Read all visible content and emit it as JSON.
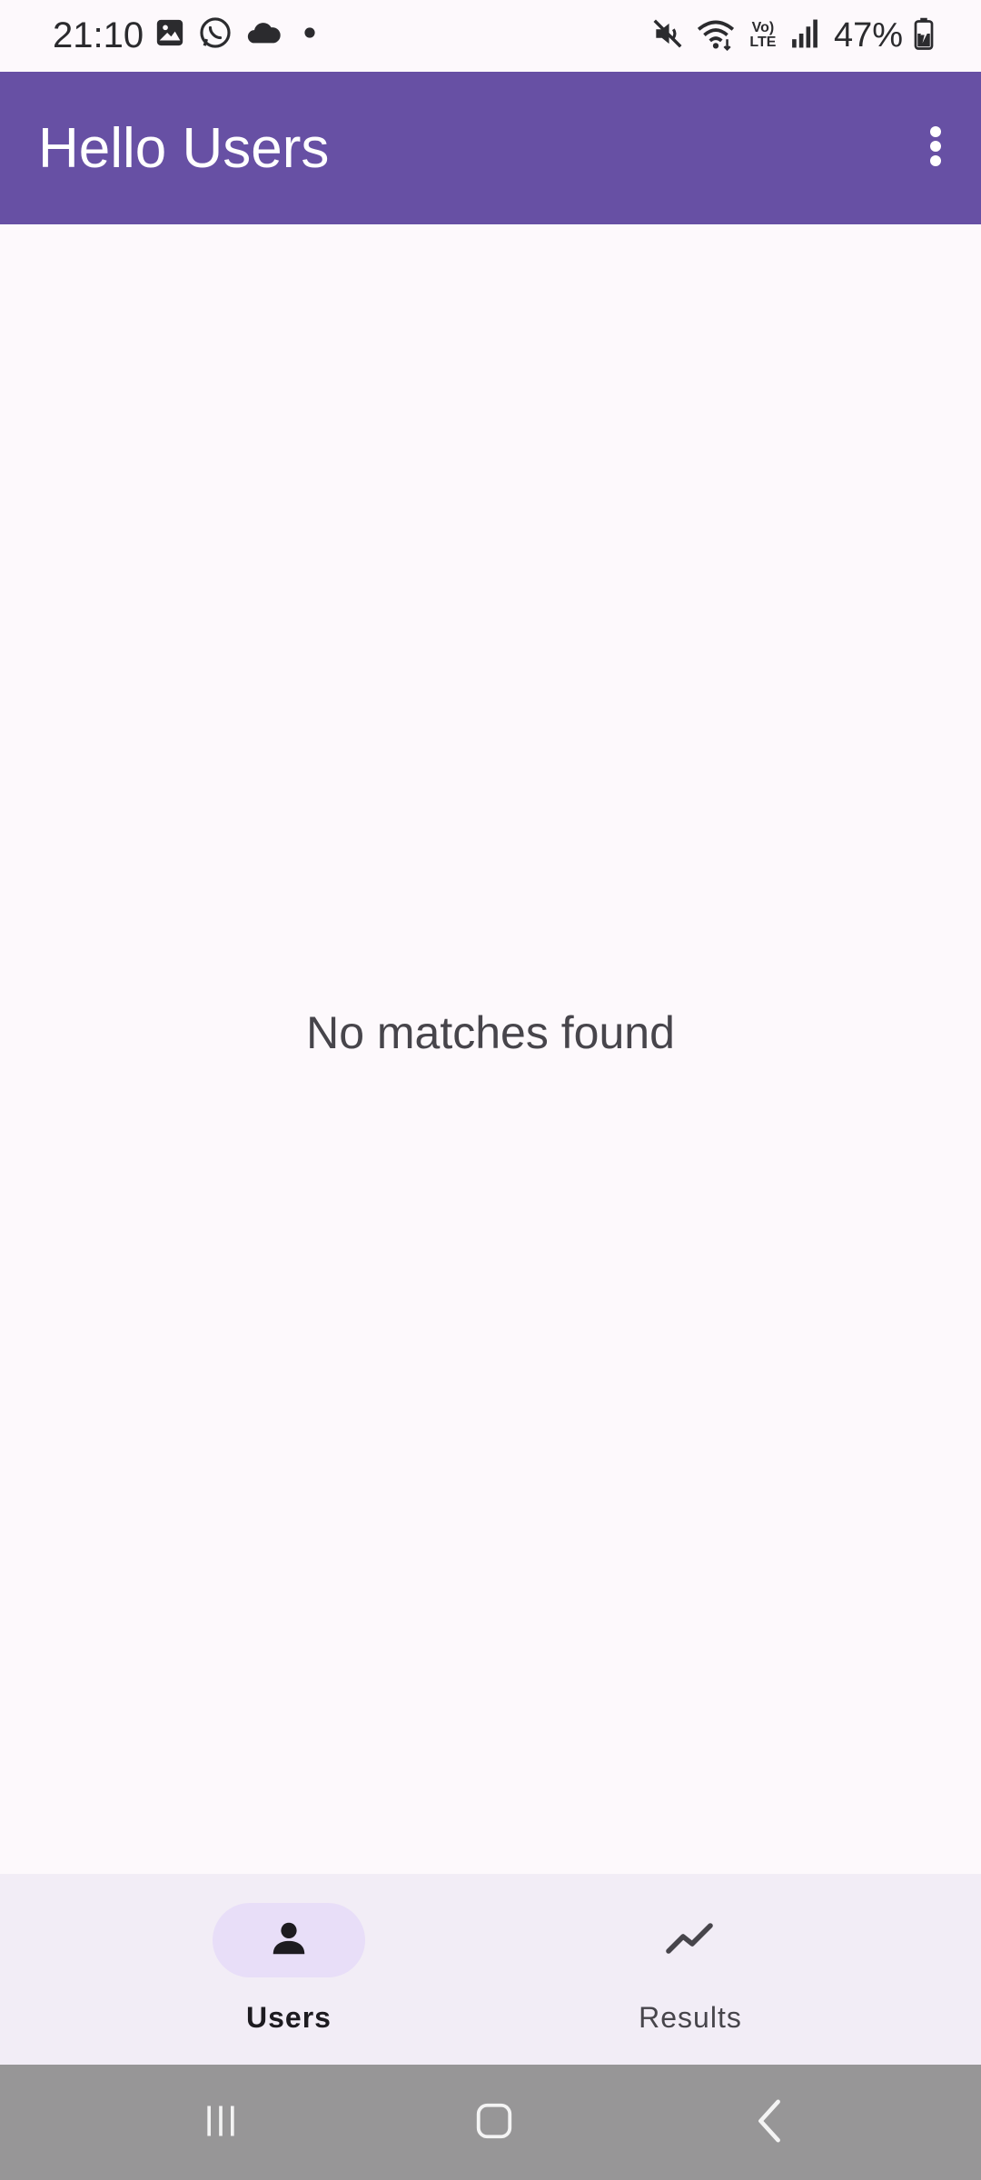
{
  "status_bar": {
    "time": "21:10",
    "battery_text": "47%",
    "network_label": "Vo) LTE",
    "icons": [
      "gallery-icon",
      "whatsapp-icon",
      "cloud-icon",
      "dot-icon",
      "mute-icon",
      "wifi-icon",
      "volte-icon",
      "signal-icon",
      "battery-charging-icon"
    ]
  },
  "app_bar": {
    "title": "Hello Users",
    "overflow_icon": "more-vert-icon",
    "background_color": "#6750a4"
  },
  "content": {
    "empty_message": "No matches found"
  },
  "bottom_nav": {
    "items": [
      {
        "label": "Users",
        "icon": "person-icon",
        "selected": true
      },
      {
        "label": "Results",
        "icon": "trending-line-icon",
        "selected": false
      }
    ],
    "active_indicator_color": "#e8def8"
  },
  "system_nav": {
    "buttons": [
      "recents-icon",
      "home-icon",
      "back-icon"
    ]
  }
}
